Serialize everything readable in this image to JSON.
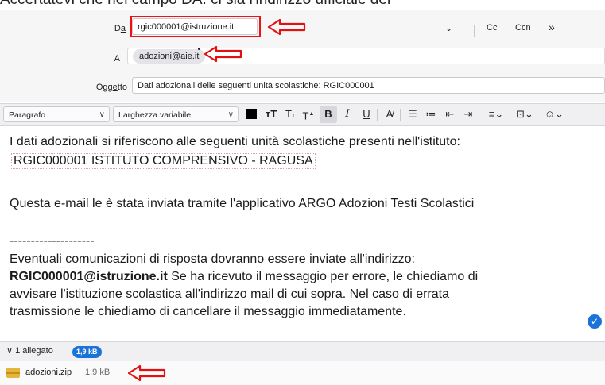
{
  "caption": "Accertatevi che nel campo DA: ci sia l'indirizzo ufficiale del",
  "header": {
    "from_label_prefix": "D",
    "from_label_underlined": "a",
    "from_value": "rgic000001@istruzione.it",
    "to_label": "A",
    "to_value": "adozioni@aie.it",
    "subject_label_prefix": "Ogg",
    "subject_label_underlined": "e",
    "subject_label_suffix": "tto",
    "subject_value": "Dati adozionali delle seguenti unità scolastiche: RGIC000001",
    "cc_label": "Cc",
    "ccn_label": "Ccn",
    "more_label": "»",
    "dropdown_label": "⌄"
  },
  "toolbar": {
    "paragraph_select": "Paragrafo",
    "width_select": "Larghezza variabile",
    "icons": [
      "text-color-icon",
      "font-bigger-icon",
      "font-smaller-icon",
      "superscript-icon",
      "bold-icon",
      "italic-icon",
      "underline-icon",
      "remove-format-icon",
      "bullet-list-icon",
      "numbered-list-icon",
      "outdent-icon",
      "indent-icon",
      "align-icon",
      "insert-icon",
      "emoji-icon"
    ]
  },
  "message": {
    "line1": "I dati adozionali si riferiscono alle seguenti unità scolastiche presenti nell'istituto:",
    "line2": "RGIC000001 ISTITUTO COMPRENSIVO - RAGUSA",
    "line3": "Questa e-mail le è stata inviata tramite l'applicativo ARGO Adozioni Testi Scolastici",
    "separator": "--------------------",
    "line4": "Eventuali comunicazioni di risposta dovranno essere inviate all'indirizzo:",
    "line5_bold": "RGIC000001@istruzione.it",
    "line5_rest": " Se ha ricevuto il messaggio per errore, le chiediamo di",
    "line6": "avvisare l'istituzione scolastica all'indirizzo mail di cui sopra. Nel caso di errata",
    "line7": "trasmissione le chiediamo di cancellare il messaggio immediatamente."
  },
  "attachments": {
    "toggle_label": "1 allegato",
    "total_size": "1,9 kB",
    "file_name": "adozioni.zip",
    "file_size": "1,9 kB"
  },
  "colors": {
    "highlight": "#e11111",
    "accent": "#1a73d9"
  }
}
